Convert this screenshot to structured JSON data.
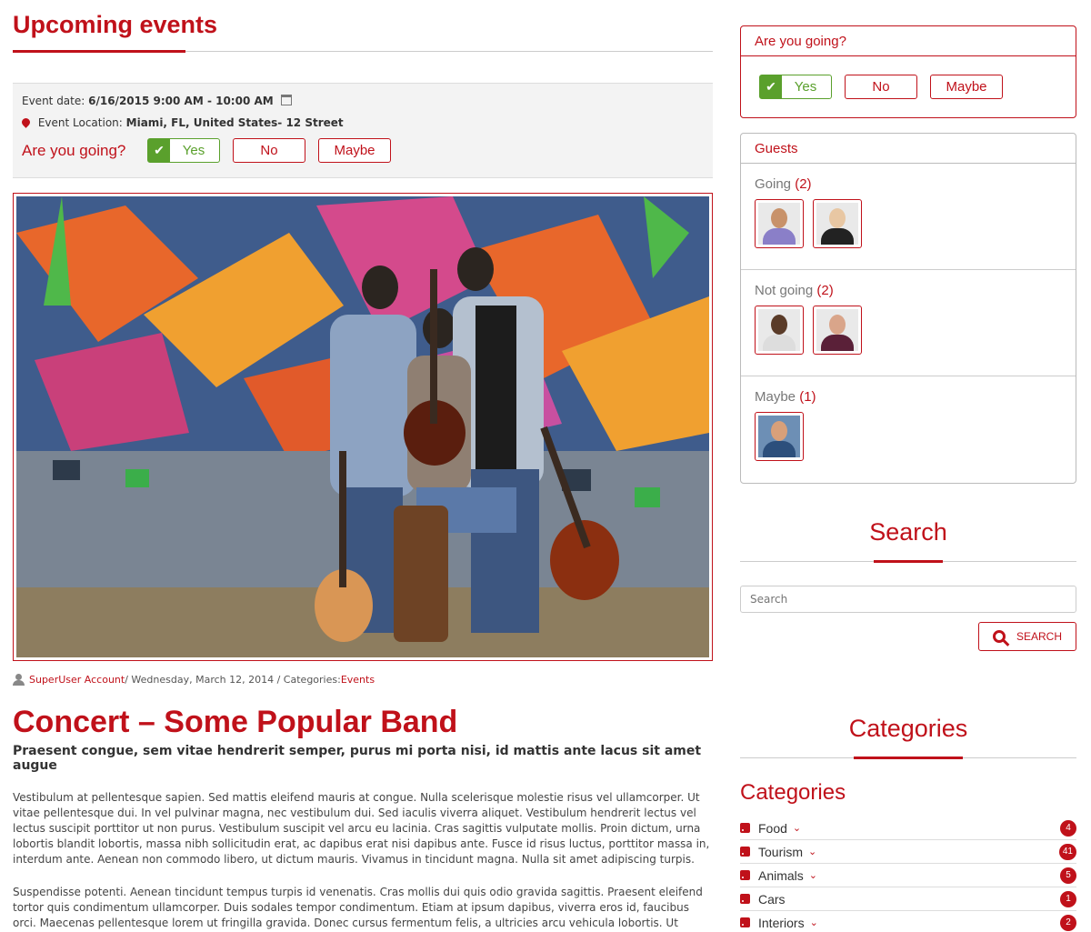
{
  "main": {
    "title": "Upcoming events",
    "event": {
      "date_label": "Event date:",
      "date_value": "6/16/2015 9:00 AM - 10:00 AM",
      "location_label": "Event Location:",
      "location_value": "Miami, FL, United States- 12 Street",
      "going_label": "Are you going?",
      "rsvp": {
        "yes": "Yes",
        "no": "No",
        "maybe": "Maybe"
      }
    },
    "meta": {
      "author": "SuperUser Account",
      "date": " / Wednesday, March 12, 2014 / Categories: ",
      "category": "Events"
    },
    "post": {
      "title": "Concert – Some Popular Band",
      "lead": "Praesent congue, sem vitae hendrerit semper, purus mi porta nisi, id mattis ante lacus sit amet augue",
      "p1": "Vestibulum at pellentesque sapien. Sed mattis eleifend mauris at congue. Nulla scelerisque molestie risus vel ullamcorper. Ut vitae pellentesque dui. In vel pulvinar magna, nec vestibulum dui. Sed iaculis viverra aliquet. Vestibulum hendrerit lectus vel lectus suscipit porttitor ut non purus. Vestibulum suscipit vel arcu eu lacinia. Cras sagittis vulputate mollis. Proin dictum, urna lobortis blandit lobortis, massa nibh sollicitudin erat, ac dapibus erat nisi dapibus ante. Fusce id risus luctus, porttitor massa in, interdum ante. Aenean non commodo libero, ut dictum mauris. Vivamus in tincidunt magna. Nulla sit amet adipiscing turpis.",
      "p2": "Suspendisse potenti. Aenean tincidunt tempus turpis id venenatis. Cras mollis dui quis odio gravida sagittis. Praesent eleifend tortor quis condimentum ullamcorper. Duis sodales tempor condimentum. Etiam at ipsum dapibus, viverra eros id, faucibus orci. Maecenas pellentesque lorem ut fringilla gravida. Donec cursus fermentum felis, a ultricies arcu vehicula lobortis. Ut pellentesque dictum dapibus. Pellentesque habitant morbi tristique senectus et netus et malesuada fames ac turpis egestas."
    }
  },
  "sidebar": {
    "rsvp_panel": {
      "title": "Are you going?",
      "yes": "Yes",
      "no": "No",
      "maybe": "Maybe"
    },
    "guests": {
      "title": "Guests",
      "going_label": "Going",
      "going_count": "(2)",
      "not_going_label": "Not going",
      "not_going_count": "(2)",
      "maybe_label": "Maybe",
      "maybe_count": "(1)"
    },
    "search": {
      "title": "Search",
      "placeholder": "Search",
      "button": "SEARCH"
    },
    "categories": {
      "widget_title": "Categories",
      "heading": "Categories",
      "items": [
        {
          "label": "Food",
          "count": "4"
        },
        {
          "label": "Tourism",
          "count": "41"
        },
        {
          "label": "Animals",
          "count": "5"
        },
        {
          "label": "Cars",
          "count": "1"
        },
        {
          "label": "Interiors",
          "count": "2"
        }
      ]
    }
  },
  "colors": {
    "accent": "#c0111a",
    "yes_green": "#5aa02c"
  },
  "icons": [
    "calendar-icon",
    "map-pin-icon",
    "check-icon",
    "user-icon",
    "search-icon",
    "rss-icon",
    "chevron-down-icon"
  ]
}
